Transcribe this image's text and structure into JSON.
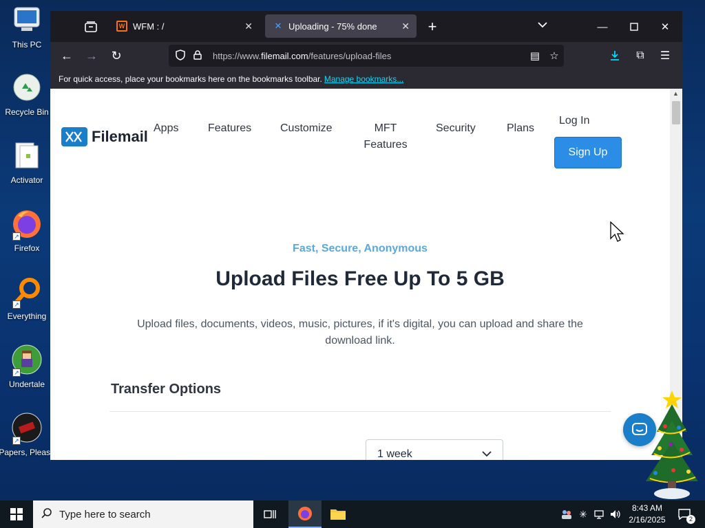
{
  "desktop": {
    "icons": [
      {
        "label": "This PC",
        "icon": "computer-icon"
      },
      {
        "label": "Recycle Bin",
        "icon": "recycle-bin-icon"
      },
      {
        "label": "Activator",
        "icon": "file-icon"
      },
      {
        "label": "Firefox",
        "icon": "firefox-icon"
      },
      {
        "label": "Everything",
        "icon": "search-app-icon"
      },
      {
        "label": "Undertale",
        "icon": "game-icon"
      },
      {
        "label": "Papers, Please",
        "icon": "game-icon"
      }
    ]
  },
  "browser": {
    "tabs": [
      {
        "title": "WFM : /",
        "active": false,
        "favicon_color": "#f97316"
      },
      {
        "title": "Uploading - 75% done",
        "active": true,
        "favicon_color": "#1b7ec8",
        "upload_progress": 0.75
      }
    ],
    "url_prefix": "https://www.",
    "url_domain": "filemail.com",
    "url_path": "/features/upload-files",
    "bookmarks_bar": {
      "message": "For quick access, place your bookmarks here on the bookmarks toolbar.",
      "link": "Manage bookmarks..."
    }
  },
  "page": {
    "logo_text": "Filemail",
    "nav": {
      "apps": "Apps",
      "features": "Features",
      "customize": "Customize",
      "mft_line1": "MFT",
      "mft_line2": "Features",
      "security": "Security",
      "plans": "Plans",
      "login": "Log In",
      "signup": "Sign Up"
    },
    "eyebrow": "Fast, Secure, Anonymous",
    "headline": "Upload Files Free Up To 5 GB",
    "subtext": "Upload files, documents, videos, music, pictures, if it's digital, you can upload and share the download link.",
    "section_title": "Transfer Options",
    "expiry_select": "1 week"
  },
  "taskbar": {
    "search_placeholder": "Type here to search",
    "time": "8:43 AM",
    "date": "2/16/2025",
    "notifications": "2"
  },
  "colors": {
    "accent": "#2b8de6",
    "eyebrow": "#5aa8dc",
    "link": "#00ddff",
    "desktop_bg": "#0b3a78"
  }
}
